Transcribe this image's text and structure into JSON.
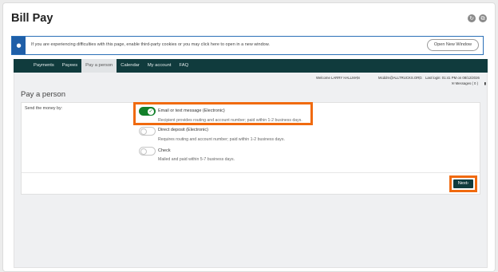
{
  "page": {
    "title": "Bill Pay",
    "header_icons": [
      "refresh-icon",
      "popout-icon"
    ]
  },
  "notice": {
    "icon": "info-icon",
    "text": "If you are experiencing difficulties with this page, enable third-party cookies or you may click here to open in a new window.",
    "button_label": "Open New Window"
  },
  "nav": {
    "items": [
      {
        "label": "Payments",
        "active": false
      },
      {
        "label": "Payees",
        "active": false
      },
      {
        "label": "Pay a person",
        "active": true
      },
      {
        "label": "Calendar",
        "active": false
      },
      {
        "label": "My account",
        "active": false
      },
      {
        "label": "FAQ",
        "active": false
      }
    ]
  },
  "session": {
    "welcome": "Welcome LARRY HALLMAN",
    "email": "Mcddrn@ALLTRUCKS.ORG",
    "last_login": "Last login: 01:41 PM on 08/12/2026",
    "messages_label": "Messages ( 0 )",
    "separator": "|"
  },
  "section": {
    "title": "Pay a person"
  },
  "form": {
    "label": "Send the money by:",
    "options": [
      {
        "title": "Email or text message (Electronic)",
        "desc": "Recipient provides routing and account number; paid within 1-2 business days.",
        "selected": true
      },
      {
        "title": "Direct deposit (Electronic)",
        "desc": "Requires routing and account number; paid within 1-2 business days.",
        "selected": false
      },
      {
        "title": "Check",
        "desc": "Mailed and paid within 5-7 business days.",
        "selected": false
      }
    ],
    "next_label": "Next",
    "next_icon": "chevron-right-icon"
  },
  "colors": {
    "nav_bg": "#103b3d",
    "toggle_on": "#12802a",
    "highlight": "#f06a0f",
    "info_blue": "#1f5fa8"
  }
}
